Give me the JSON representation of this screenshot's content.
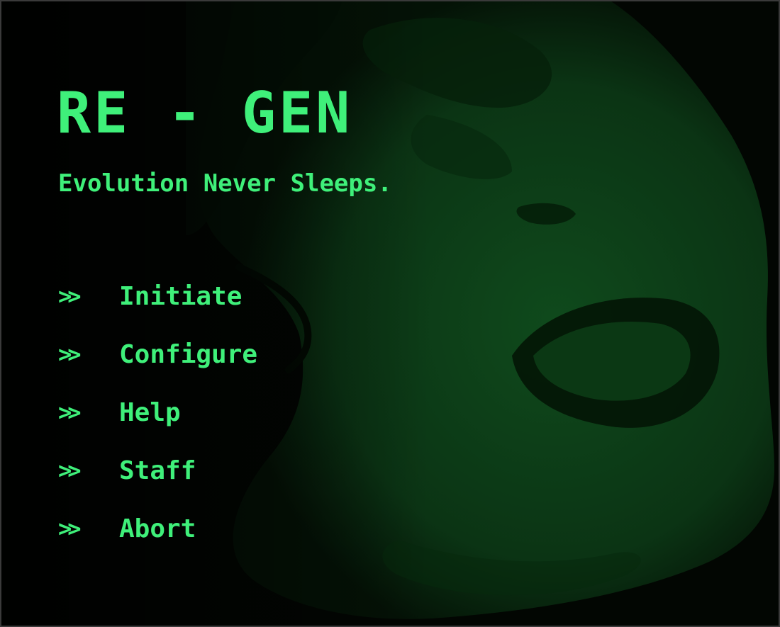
{
  "game": {
    "title": "RE - GEN",
    "tagline": "Evolution Never Sleeps."
  },
  "menu": {
    "marker": ">>",
    "items": [
      {
        "label": "Initiate"
      },
      {
        "label": "Configure"
      },
      {
        "label": "Help"
      },
      {
        "label": "Staff"
      },
      {
        "label": "Abort"
      }
    ]
  },
  "colors": {
    "text": "#3ff07a",
    "background_tint": "#0d3a15"
  }
}
